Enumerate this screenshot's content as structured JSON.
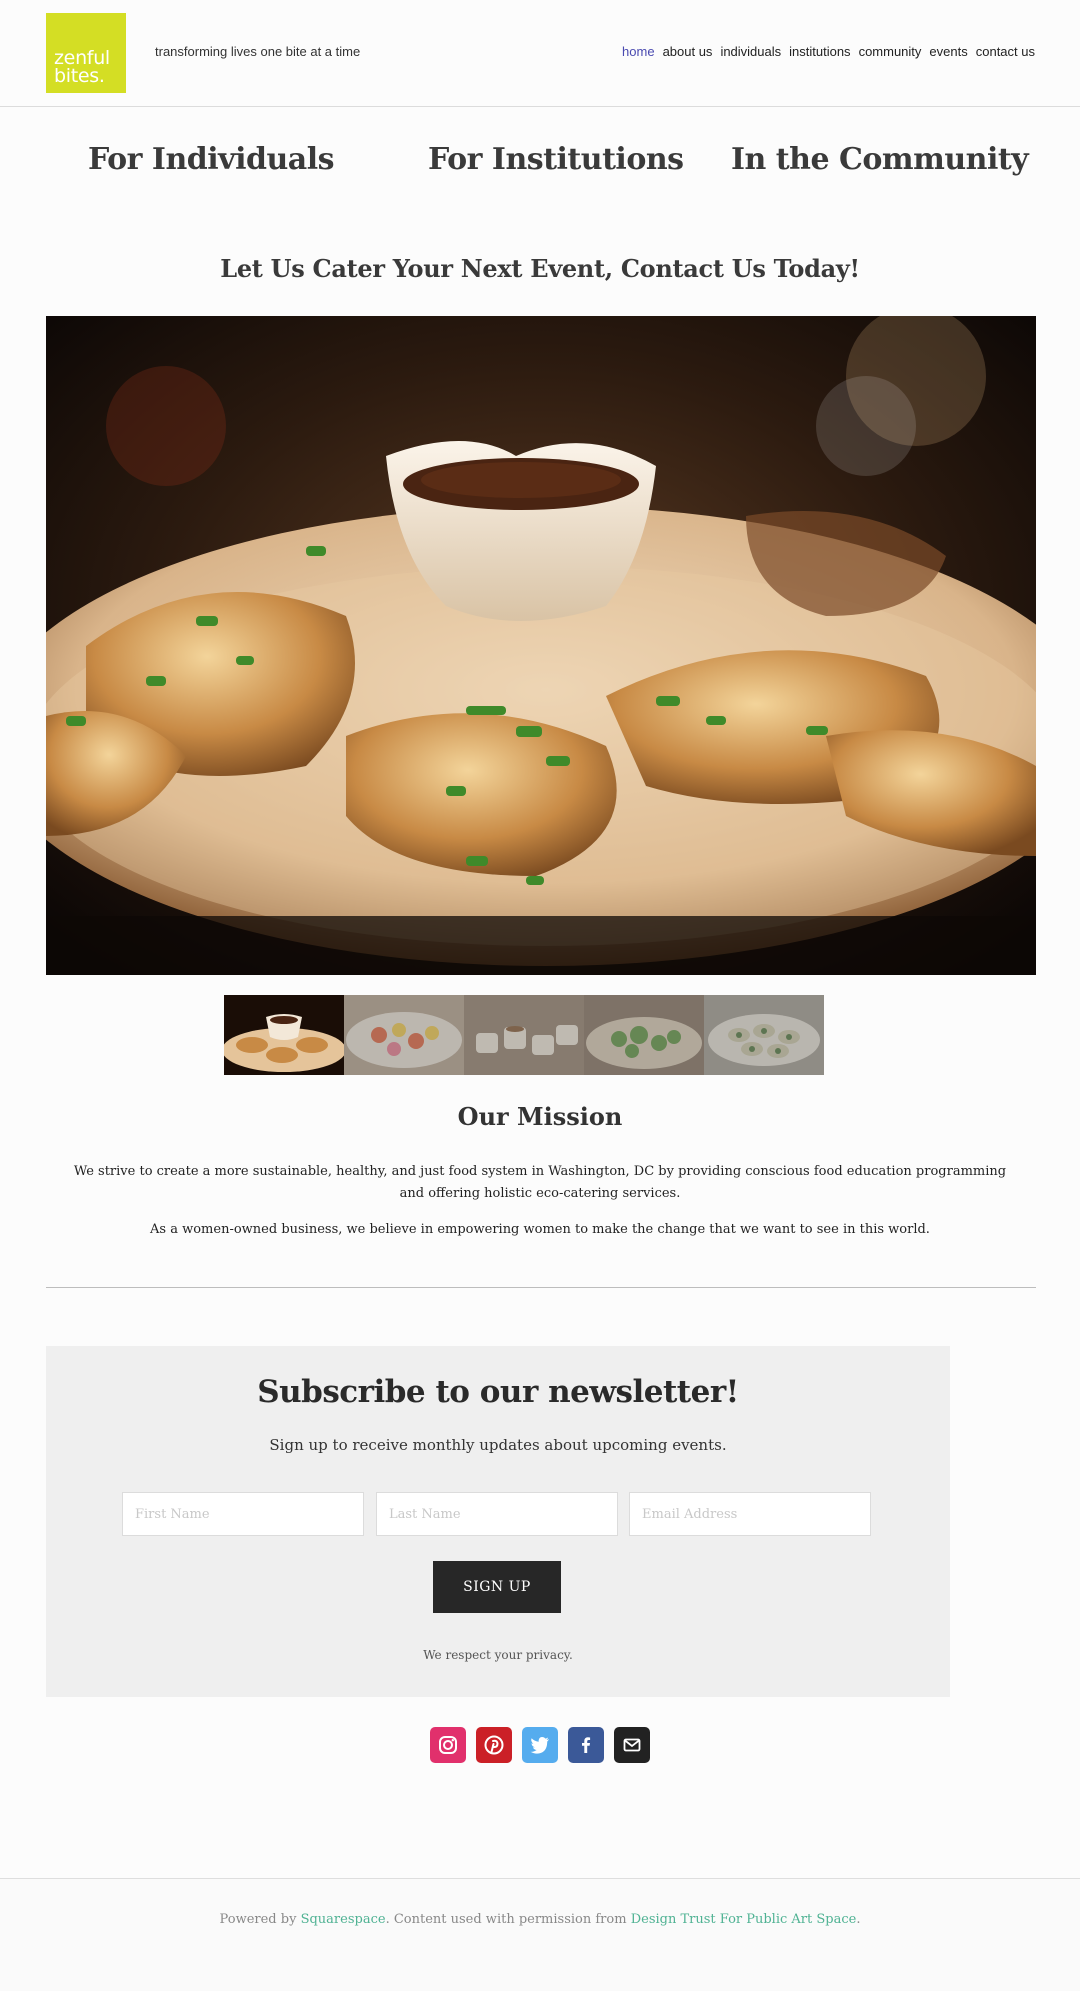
{
  "colors": {
    "logo_bg": "#d4de24",
    "nav_active": "#4a4ab0",
    "button_bg": "#272727",
    "link": "#4fb293",
    "instagram": "#e1306c",
    "pinterest": "#cb2027",
    "twitter": "#55acee",
    "facebook": "#3b5998",
    "email": "#222222"
  },
  "header": {
    "logo_line1": "zenful",
    "logo_line2": "bites.",
    "tagline": "transforming lives one bite at a time",
    "nav": [
      {
        "label": "home",
        "active": true
      },
      {
        "label": "about us"
      },
      {
        "label": "individuals"
      },
      {
        "label": "institutions"
      },
      {
        "label": "community"
      },
      {
        "label": "events"
      },
      {
        "label": "contact us"
      }
    ]
  },
  "categories": [
    "For Individuals",
    "For Institutions",
    "In the Community"
  ],
  "cta": "Let Us Cater Your Next Event, Contact Us Today!",
  "gallery": {
    "thumbnails": 5,
    "active_index": 0
  },
  "mission": {
    "title": "Our Mission",
    "p1": "We strive to create a more sustainable, healthy, and just food system in Washington, DC by providing conscious food education programming and offering holistic eco-catering services.",
    "p2": "As a women-owned business, we believe in empowering women to make the change that we want to see in this world."
  },
  "newsletter": {
    "title": "Subscribe to our newsletter!",
    "subtitle": "Sign up to receive monthly updates about upcoming events.",
    "first_name_placeholder": "First Name",
    "last_name_placeholder": "Last Name",
    "email_placeholder": "Email Address",
    "button": "SIGN UP",
    "privacy": "We respect your privacy."
  },
  "social": [
    "instagram-icon",
    "pinterest-icon",
    "twitter-icon",
    "facebook-icon",
    "email-icon"
  ],
  "footer": {
    "prefix": "Powered by",
    "platform": "Squarespace",
    "middle": ".  Content used with permission from",
    "credit": "Design Trust For Public Art Space",
    "suffix": "."
  }
}
